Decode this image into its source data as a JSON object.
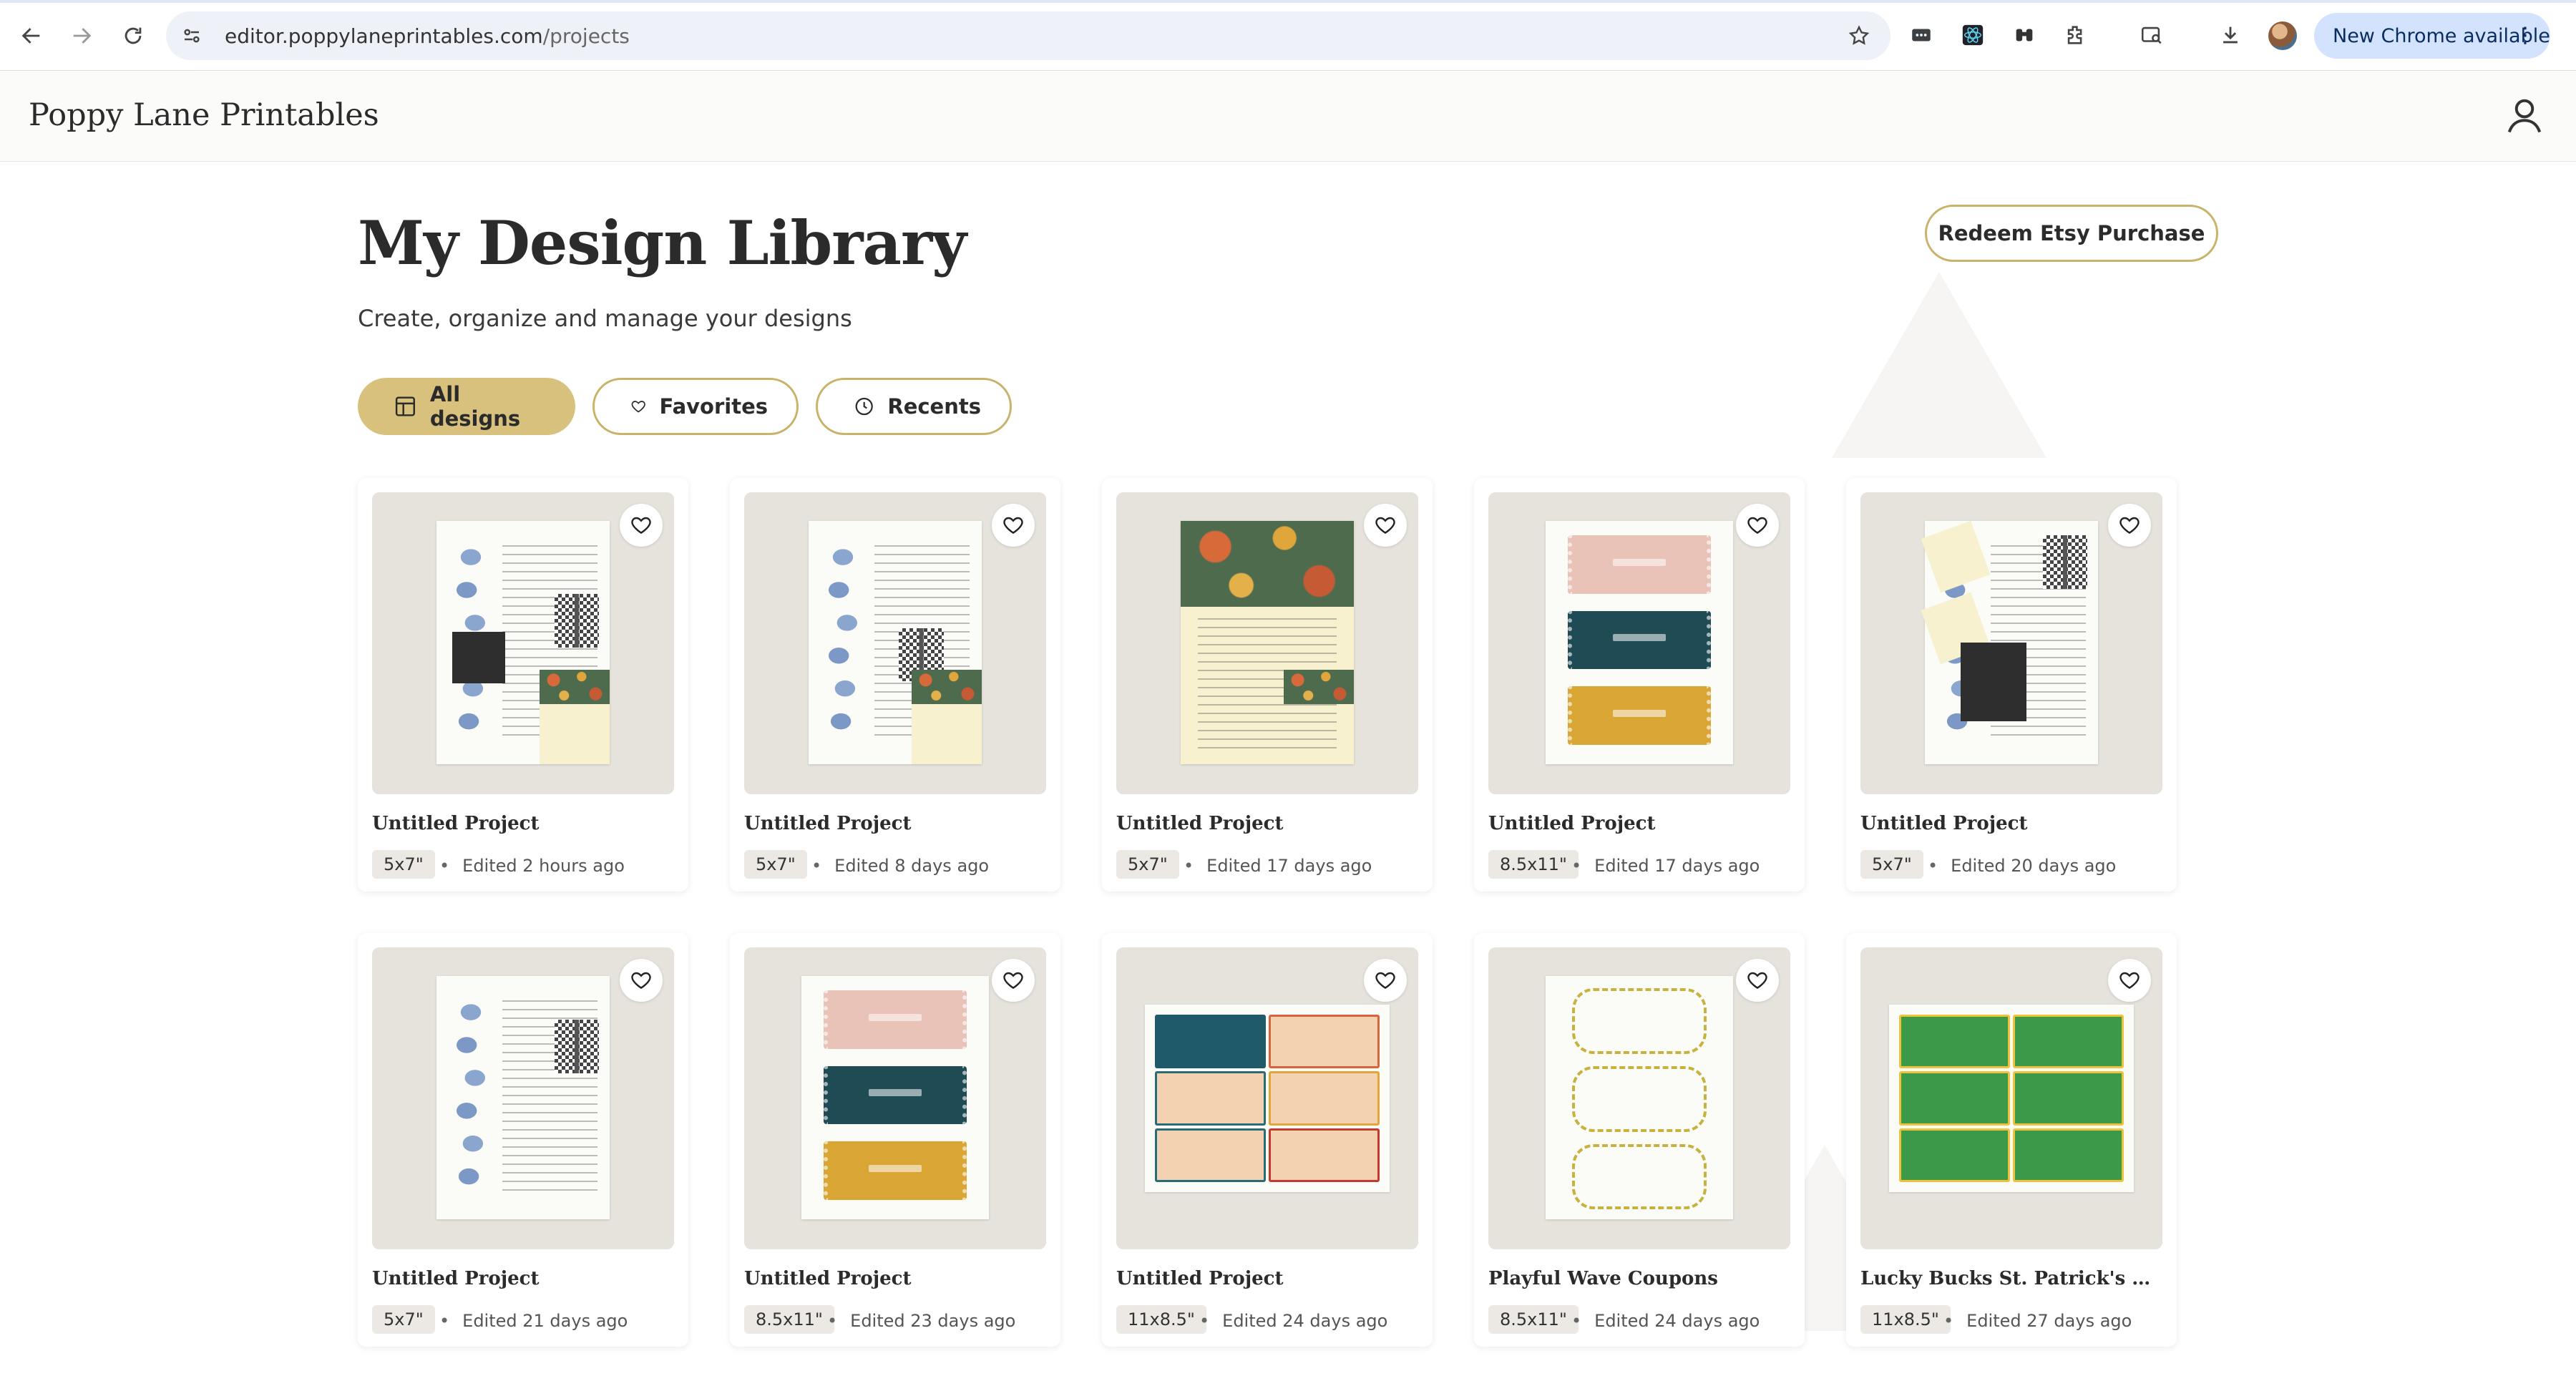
{
  "browser": {
    "url_domain": "editor.poppylaneprintables.com",
    "url_path": "/projects",
    "update_label": "New Chrome available"
  },
  "app": {
    "brand": "Poppy Lane Printables"
  },
  "page": {
    "title": "My Design Library",
    "subtitle": "Create, organize and manage your designs",
    "redeem_label": "Redeem Etsy Purchase"
  },
  "filters": [
    {
      "label": "All designs",
      "active": true,
      "icon": "layout-icon"
    },
    {
      "label": "Favorites",
      "active": false,
      "icon": "heart-icon"
    },
    {
      "label": "Recents",
      "active": false,
      "icon": "clock-icon"
    }
  ],
  "projects": [
    {
      "title": "Untitled Project",
      "size": "5x7\"",
      "edited": "Edited 2 hours ago",
      "preview": "invite-blue-black"
    },
    {
      "title": "Untitled Project",
      "size": "5x7\"",
      "edited": "Edited 8 days ago",
      "preview": "invite-blue-qr"
    },
    {
      "title": "Untitled Project",
      "size": "5x7\"",
      "edited": "Edited 17 days ago",
      "preview": "invite-floral"
    },
    {
      "title": "Untitled Project",
      "size": "8.5x11\"",
      "edited": "Edited 17 days ago",
      "preview": "tickets-english"
    },
    {
      "title": "Untitled Project",
      "size": "5x7\"",
      "edited": "Edited 20 days ago",
      "preview": "invite-cream-black"
    },
    {
      "title": "Untitled Project",
      "size": "5x7\"",
      "edited": "Edited 21 days ago",
      "preview": "invite-blue"
    },
    {
      "title": "Untitled Project",
      "size": "8.5x11\"",
      "edited": "Edited 23 days ago",
      "preview": "tickets-german"
    },
    {
      "title": "Untitled Project",
      "size": "11x8.5\"",
      "edited": "Edited 24 days ago",
      "preview": "coupon-book"
    },
    {
      "title": "Playful Wave Coupons",
      "size": "8.5x11\"",
      "edited": "Edited 24 days ago",
      "preview": "wave-coupons"
    },
    {
      "title": "Lucky Bucks St. Patrick's Day ...",
      "size": "11x8.5\"",
      "edited": "Edited 27 days ago",
      "preview": "lucky-bucks"
    }
  ],
  "colors": {
    "accent": "#d7c17d",
    "accent_border": "#c9b36b",
    "thumb_bg": "#e6e2dc"
  }
}
